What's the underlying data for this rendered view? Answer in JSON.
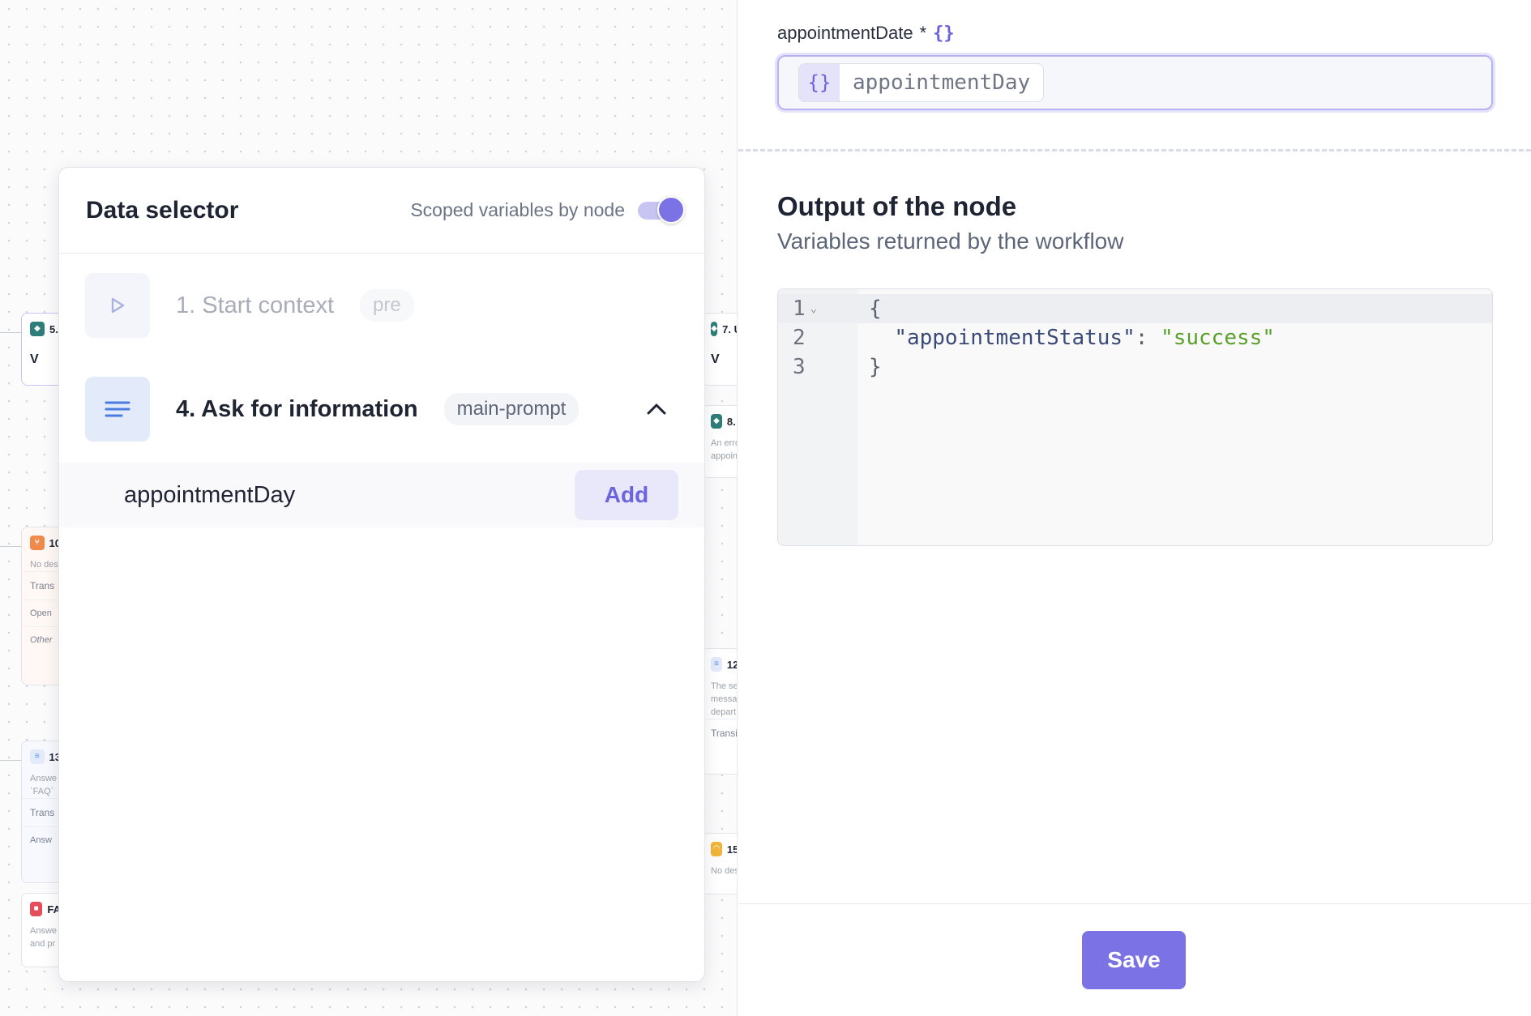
{
  "canvas": {
    "nodes": [
      {
        "id": "n5",
        "label": "5.",
        "icon_color": "#2f7d7a",
        "rows": [
          "V"
        ]
      },
      {
        "id": "n7",
        "label": "7. U",
        "icon_color": "#2f7d7a",
        "rows": [
          "V"
        ]
      },
      {
        "id": "n8",
        "label": "8. /",
        "icon_color": "#2f7d7a",
        "subs": [
          "An error",
          "appointn"
        ]
      },
      {
        "id": "n10",
        "label": "10",
        "icon_color": "#f08a4b",
        "subs": [
          "No des"
        ],
        "rows": [
          "Trans",
          "Open",
          "Other"
        ]
      },
      {
        "id": "n12",
        "label": "12.",
        "icon_color": "#5b8def",
        "subs": [
          "The serv",
          "messag",
          "departm"
        ],
        "rows": [
          "Transit"
        ]
      },
      {
        "id": "n13",
        "label": "13",
        "icon_color": "#5b8def",
        "subs": [
          "Answe",
          "`FAQ`"
        ],
        "rows": [
          "Trans",
          "Answ"
        ]
      },
      {
        "id": "n15",
        "label": "15.",
        "icon_color": "#f2b53a",
        "subs": [
          "No desc"
        ]
      },
      {
        "id": "nfa",
        "label": "FA",
        "icon_color": "#e54d5b",
        "subs": [
          "Answe",
          "and pr"
        ]
      }
    ]
  },
  "data_selector": {
    "title": "Data selector",
    "scoped_label": "Scoped variables by node",
    "scoped_enabled": true,
    "nodes": [
      {
        "label": "1. Start context",
        "tag": "pre",
        "icon": "play-icon",
        "state": "disabled"
      },
      {
        "label": "4. Ask for information",
        "tag": "main-prompt",
        "icon": "text-lines-icon",
        "state": "expanded"
      }
    ],
    "variables": [
      {
        "name": "appointmentDay",
        "action": "Add"
      }
    ]
  },
  "form": {
    "field_label": "appointmentDate",
    "required_mark": "*",
    "field_icon": "{}",
    "chip_icon": "{}",
    "chip_value": "appointmentDay"
  },
  "output": {
    "title": "Output of the node",
    "subtitle": "Variables returned by the workflow",
    "editor": {
      "line_numbers": [
        "1",
        "2",
        "3"
      ],
      "open_brace": "{",
      "key": "\"appointmentStatus\"",
      "colon": ": ",
      "value": "\"success\"",
      "close_brace": "}"
    }
  },
  "footer": {
    "save_label": "Save"
  },
  "colors": {
    "accent": "#7b72e6",
    "accent_soft": "#e9e8fb",
    "string": "#5aa02c"
  }
}
